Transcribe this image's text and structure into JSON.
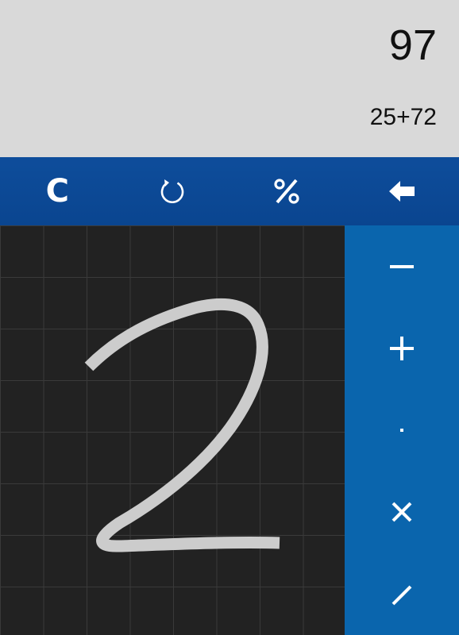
{
  "display": {
    "result": "97",
    "expression": "25+72"
  },
  "toolbar": {
    "clear_label": "C",
    "buttons": [
      "clear",
      "history",
      "percent",
      "backspace"
    ]
  },
  "operators": [
    {
      "name": "minus"
    },
    {
      "name": "plus"
    },
    {
      "name": "decimal-point"
    },
    {
      "name": "multiply"
    },
    {
      "name": "divide"
    }
  ],
  "handwriting": {
    "recognized_stroke": "2"
  },
  "colors": {
    "display_bg": "#d9d9d9",
    "toolbar_bg": "#0e4d9b",
    "operators_bg": "#0a65ad",
    "canvas_bg": "#222222",
    "stroke": "#cccccc"
  }
}
